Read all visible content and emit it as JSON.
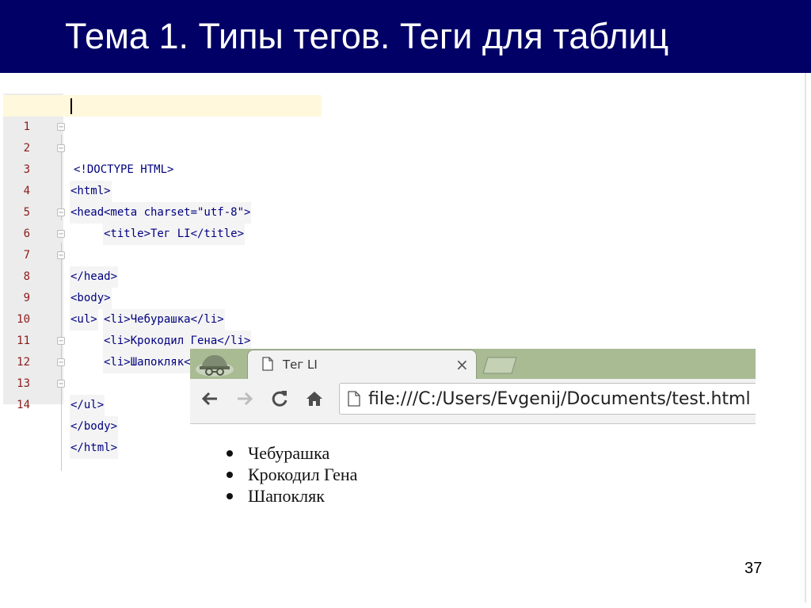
{
  "slide": {
    "title": "Тема 1. Типы тегов. Теги для таблиц",
    "page_number": "37"
  },
  "editor": {
    "lines": [
      {
        "no": "1",
        "text": "<!DOCTYPE HTML>"
      },
      {
        "no": "2",
        "text": "<html>"
      },
      {
        "no": "3",
        "text": "<head>"
      },
      {
        "no": "4",
        "text": "<meta charset=\"utf-8\">"
      },
      {
        "no": "5",
        "text": "<title>Тег LI</title>"
      },
      {
        "no": "6",
        "text": "</head>"
      },
      {
        "no": "7",
        "text": "<body>"
      },
      {
        "no": "8",
        "text": "<ul>"
      },
      {
        "no": "9",
        "text": "<li>Чебурашка</li>"
      },
      {
        "no": "10",
        "text": "<li>Крокодил Гена</li>"
      },
      {
        "no": "11",
        "text": "<li>Шапокляк</li>"
      },
      {
        "no": "12",
        "text": "</ul>"
      },
      {
        "no": "13",
        "text": "</body>"
      },
      {
        "no": "14",
        "text": "</html>"
      }
    ]
  },
  "browser": {
    "tab_title": "Тег LI",
    "tab_close": "×",
    "address": "file:///C:/Users/Evgenij/Documents/test.html",
    "icons": [
      "incognito-icon",
      "page-icon",
      "close-icon",
      "new-tab-icon",
      "back-icon",
      "forward-icon",
      "reload-icon",
      "home-icon"
    ],
    "list_items": [
      "Чебурашка",
      "Крокодил Гена",
      "Шапокляк"
    ]
  },
  "colors": {
    "title_band": "#000066",
    "tabstrip": "#a8bb93",
    "line_numbers": "#8b1a1a",
    "code_tags": "#000080",
    "current_line": "#fff8dc"
  }
}
